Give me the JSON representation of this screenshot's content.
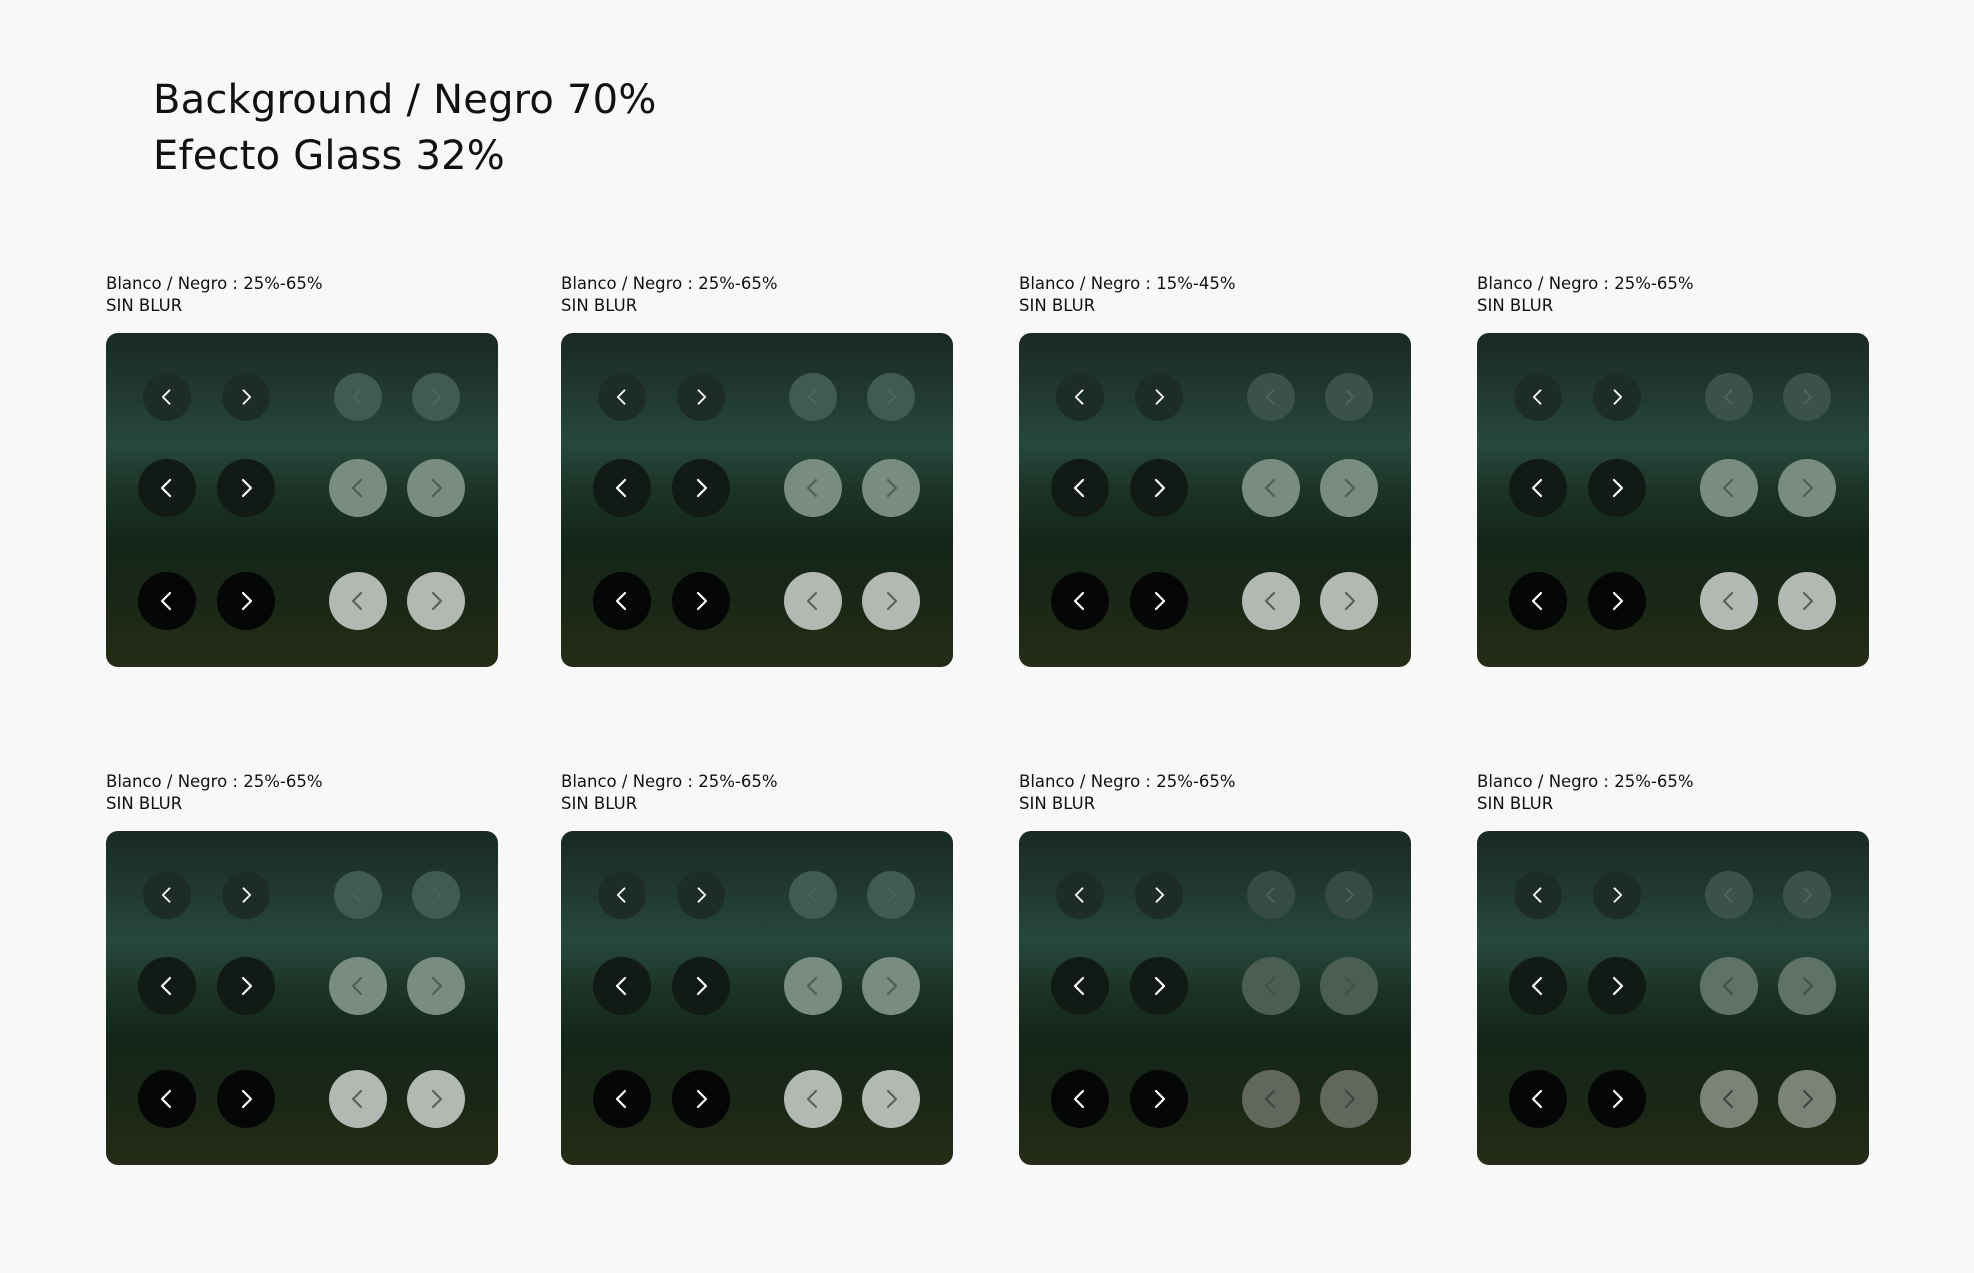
{
  "heading": {
    "line1": "Background / Negro 70%",
    "line2": "Efecto Glass 32%"
  },
  "icons": {
    "prev": "chevron-left-icon",
    "next": "chevron-right-icon"
  },
  "variants": [
    {
      "caption_line1": "Blanco / Negro : 25%-65%",
      "caption_line2": "SIN BLUR",
      "dark": [
        "#1e2c28",
        "#111a15",
        "#050706"
      ],
      "light": [
        "#405b51",
        "#788c82",
        "#b1b9b2"
      ],
      "light_icon": [
        "#4d6a5e",
        "#4b5f55",
        "#59625b"
      ]
    },
    {
      "caption_line1": "Blanco / Negro : 25%-65%",
      "caption_line2": "SIN BLUR",
      "dark": [
        "#1e2c28",
        "#111a15",
        "#050706"
      ],
      "light": [
        "#405b51",
        "#788c82",
        "#b1b9b2"
      ],
      "light_icon": [
        "#4d6a5e",
        "#4b5f55",
        "#59625b"
      ]
    },
    {
      "caption_line1": "Blanco / Negro : 15%-45%",
      "caption_line2": "SIN BLUR",
      "dark": [
        "#1e2c28",
        "#111a15",
        "#050706"
      ],
      "light": [
        "#3a5248",
        "#788c82",
        "#b1b9b2"
      ],
      "light_icon": [
        "#4f665d",
        "#4b5f55",
        "#59625b"
      ]
    },
    {
      "caption_line1": "Blanco / Negro : 25%-65%",
      "caption_line2": "SIN BLUR",
      "dark": [
        "#1e2c28",
        "#111a15",
        "#050706"
      ],
      "light": [
        "#3a5248",
        "#788c82",
        "#b1b9b2"
      ],
      "light_icon": [
        "#4f665d",
        "#4b5f55",
        "#59625b"
      ]
    },
    {
      "caption_line1": "Blanco / Negro : 25%-65%",
      "caption_line2": "SIN BLUR",
      "dark": [
        "#1e2c28",
        "#111a15",
        "#050706"
      ],
      "light": [
        "#405b51",
        "#788c82",
        "#b1b9b2"
      ],
      "light_icon": [
        "#4a6358",
        "#4b5f55",
        "#59625b"
      ]
    },
    {
      "caption_line1": "Blanco / Negro : 25%-65%",
      "caption_line2": "SIN BLUR",
      "dark": [
        "#1e2c28",
        "#111a15",
        "#050706"
      ],
      "light": [
        "#405b51",
        "#788c82",
        "#b1b9b2"
      ],
      "light_icon": [
        "#4a6358",
        "#4b5f55",
        "#59625b"
      ]
    },
    {
      "caption_line1": "Blanco / Negro : 25%-65%",
      "caption_line2": "SIN BLUR",
      "dark": [
        "#1e2c28",
        "#111a15",
        "#050706"
      ],
      "light": [
        "#364c43",
        "#4a5e54",
        "#61675c"
      ],
      "light_icon": [
        "#4c645a",
        "#3e5047",
        "#3f463e"
      ]
    },
    {
      "caption_line1": "Blanco / Negro : 25%-65%",
      "caption_line2": "SIN BLUR",
      "dark": [
        "#1e2c28",
        "#111a15",
        "#050706"
      ],
      "light": [
        "#3a5248",
        "#5f7268",
        "#7b8278"
      ],
      "light_icon": [
        "#4f665d",
        "#404f47",
        "#3f463e"
      ]
    }
  ]
}
